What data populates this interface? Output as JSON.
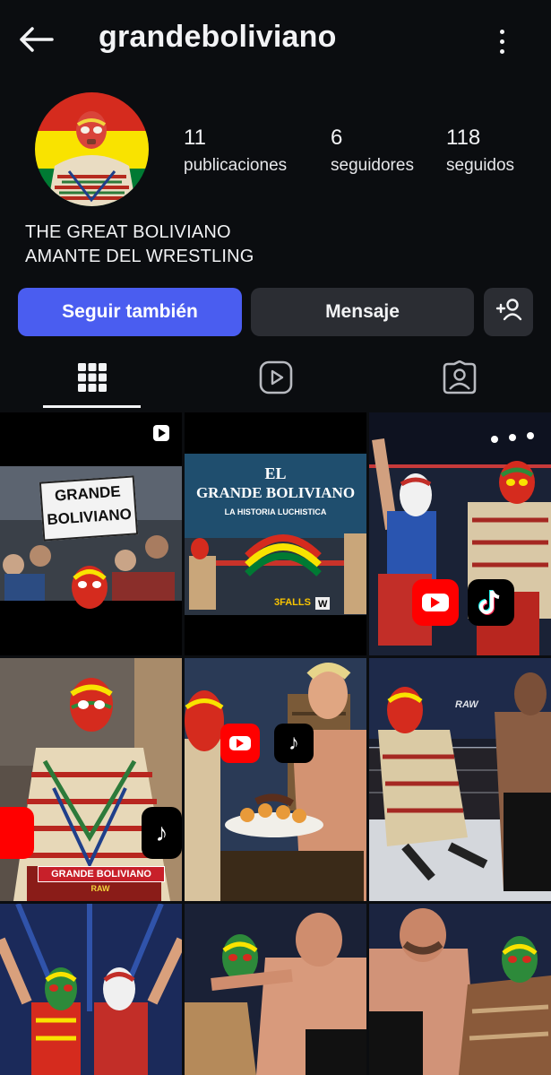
{
  "header": {
    "username": "grandeboliviano",
    "back_icon": "arrow-left-icon",
    "menu_icon": "more-vertical-icon"
  },
  "profile": {
    "stats": [
      {
        "value": "11",
        "label": "publicaciones"
      },
      {
        "value": "6",
        "label": "seguidores"
      },
      {
        "value": "118",
        "label": "seguidos"
      }
    ],
    "bio_lines": [
      "THE GREAT BOLIVIANO",
      "AMANTE DEL WRESTLING"
    ]
  },
  "actions": {
    "follow_label": "Seguir también",
    "message_label": "Mensaje",
    "add_icon": "add-person-icon"
  },
  "tabs": [
    {
      "icon": "grid-icon",
      "active": true
    },
    {
      "icon": "reels-icon",
      "active": false
    },
    {
      "icon": "tagged-icon",
      "active": false
    }
  ],
  "posts": [
    {
      "text": [
        "GRANDE",
        "BOLIVIANO"
      ],
      "badge": "play-icon"
    },
    {
      "text": [
        "EL",
        "GRANDE BOLIVIANO",
        "LA HISTORIA LUCHISTICA",
        "3FALLS"
      ]
    },
    {
      "badges": [
        "youtube-icon",
        "tiktok-icon"
      ]
    },
    {
      "text": [
        "GRANDE BOLIVIANO",
        "RAW"
      ],
      "badges": [
        "youtube-icon",
        "tiktok-icon"
      ]
    },
    {
      "badges": [
        "youtube-icon",
        "tiktok-icon"
      ]
    },
    {
      "text": [
        "RAW"
      ]
    },
    {},
    {},
    {}
  ],
  "colors": {
    "background": "#0b0d10",
    "follow_button": "#4a5df0",
    "secondary_button": "#2b2d33",
    "bolivia_red": "#d52b1e",
    "bolivia_yellow": "#f9e300",
    "bolivia_green": "#007a33"
  }
}
